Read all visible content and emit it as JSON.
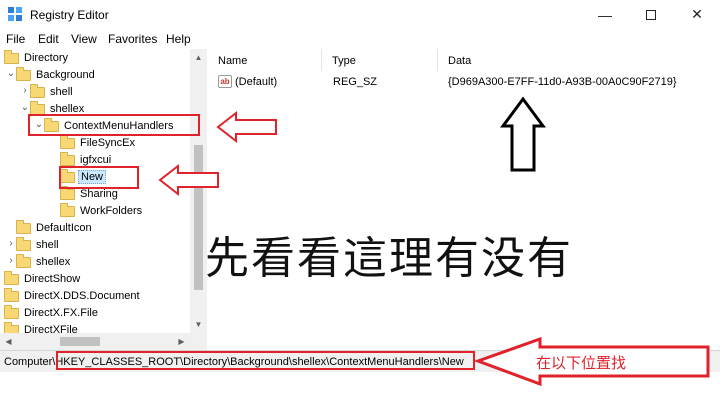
{
  "window": {
    "title": "Registry Editor",
    "controls": {
      "minimize": "—",
      "close": "✕"
    }
  },
  "menu": [
    "File",
    "Edit",
    "View",
    "Favorites",
    "Help"
  ],
  "tree": [
    {
      "label": "Directory",
      "indent": 0,
      "chevron": ""
    },
    {
      "label": "Background",
      "indent": 1,
      "chevron": "⌄"
    },
    {
      "label": "shell",
      "indent": 2,
      "chevron": "›"
    },
    {
      "label": "shellex",
      "indent": 2,
      "chevron": "⌄"
    },
    {
      "label": "ContextMenuHandlers",
      "indent": 3,
      "chevron": "⌄"
    },
    {
      "label": "FileSyncEx",
      "indent": 4,
      "chevron": ""
    },
    {
      "label": "igfxcui",
      "indent": 4,
      "chevron": ""
    },
    {
      "label": "New",
      "indent": 4,
      "chevron": "",
      "selected": true
    },
    {
      "label": "Sharing",
      "indent": 4,
      "chevron": ""
    },
    {
      "label": "WorkFolders",
      "indent": 4,
      "chevron": ""
    },
    {
      "label": "DefaultIcon",
      "indent": 1,
      "chevron": ""
    },
    {
      "label": "shell",
      "indent": 1,
      "chevron": "›"
    },
    {
      "label": "shellex",
      "indent": 1,
      "chevron": "›"
    },
    {
      "label": "DirectShow",
      "indent": 0,
      "chevron": ""
    },
    {
      "label": "DirectX.DDS.Document",
      "indent": 0,
      "chevron": ""
    },
    {
      "label": "DirectX.FX.File",
      "indent": 0,
      "chevron": ""
    },
    {
      "label": "DirectXFile",
      "indent": 0,
      "chevron": ""
    }
  ],
  "columns": {
    "name": "Name",
    "type": "Type",
    "data": "Data"
  },
  "values": [
    {
      "icon": "ab",
      "name": "(Default)",
      "type": "REG_SZ",
      "data": "{D969A300-E7FF-11d0-A93B-00A0C90F2719}"
    }
  ],
  "statusbar": {
    "path": "Computer\\HKEY_CLASSES_ROOT\\Directory\\Background\\shellex\\ContextMenuHandlers\\New"
  },
  "annotations": {
    "main_text": "先看看這理有没有",
    "status_text": "在以下位置找",
    "color": "#e0232a"
  }
}
